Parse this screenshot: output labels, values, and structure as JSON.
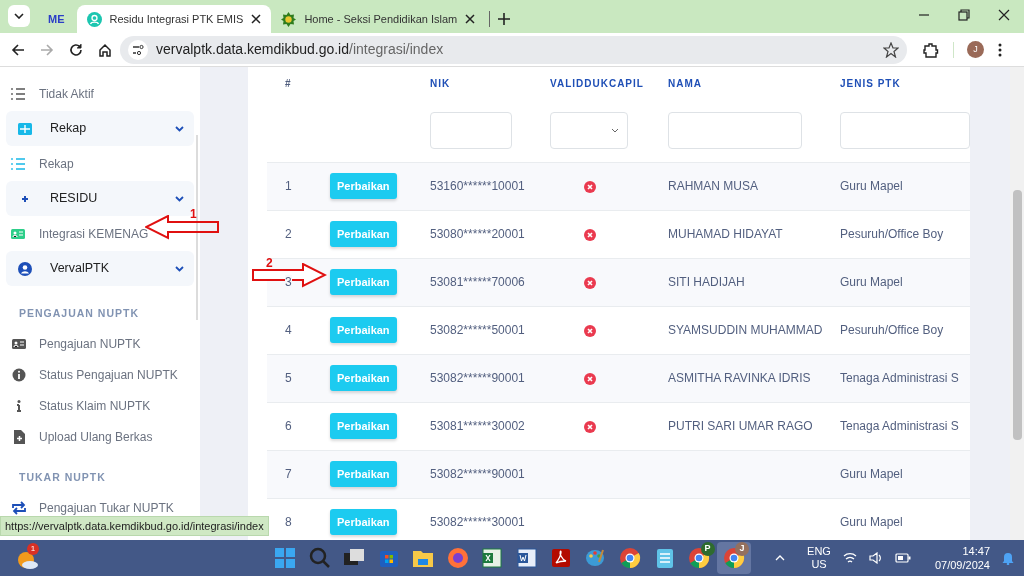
{
  "browser": {
    "tabs": [
      {
        "favicon_text": "ME",
        "selected": false
      },
      {
        "title": "Residu Integrasi PTK EMIS",
        "selected": true
      },
      {
        "title": "Home - Seksi Pendidikan Islam",
        "selected": false
      }
    ],
    "url": {
      "host": "vervalptk.data.kemdikbud.go.id",
      "path": "/integrasi/index"
    },
    "profile_letter": "J",
    "status_url": "https://vervalptk.data.kemdikbud.go.id/integrasi/index"
  },
  "sidebar": {
    "items": [
      {
        "kind": "link",
        "label": "Tidak Aktif"
      },
      {
        "kind": "group",
        "label": "Rekap",
        "expanded": true
      },
      {
        "kind": "link",
        "label": "Rekap"
      },
      {
        "kind": "group",
        "label": "RESIDU",
        "expanded": true
      },
      {
        "kind": "link",
        "label": "Integrasi KEMENAG"
      },
      {
        "kind": "group",
        "label": "VervalPTK",
        "expanded": true
      },
      {
        "kind": "heading",
        "label": "PENGAJUAN NUPTK"
      },
      {
        "kind": "link",
        "label": "Pengajuan NUPTK"
      },
      {
        "kind": "link",
        "label": "Status Pengajuan NUPTK"
      },
      {
        "kind": "link",
        "label": "Status Klaim NUPTK"
      },
      {
        "kind": "link",
        "label": "Upload Ulang Berkas"
      },
      {
        "kind": "heading",
        "label": "TUKAR NUPTK"
      },
      {
        "kind": "link",
        "label": "Pengajuan Tukar NUPTK"
      }
    ]
  },
  "table": {
    "columns": [
      "#",
      "NIK",
      "VALIDDUKCAPIL",
      "NAMA",
      "JENIS PTK"
    ],
    "filters": [
      {
        "kind": "text"
      },
      {
        "kind": "select"
      },
      {
        "kind": "text"
      },
      {
        "kind": "text"
      }
    ],
    "rows": [
      {
        "no": "1",
        "action": "Perbaikan",
        "nik": "53160******10001",
        "invalid": true,
        "nama": "RAHMAN MUSA",
        "jenis": "Guru Mapel"
      },
      {
        "no": "2",
        "action": "Perbaikan",
        "nik": "53080******20001",
        "invalid": true,
        "nama": "MUHAMAD HIDAYAT",
        "jenis": "Pesuruh/Office Boy"
      },
      {
        "no": "3",
        "action": "Perbaikan",
        "nik": "53081******70006",
        "invalid": true,
        "nama": "SITI HADIJAH",
        "jenis": "Guru Mapel"
      },
      {
        "no": "4",
        "action": "Perbaikan",
        "nik": "53082******50001",
        "invalid": true,
        "nama": "SYAMSUDDIN MUHAMMAD",
        "jenis": "Pesuruh/Office Boy"
      },
      {
        "no": "5",
        "action": "Perbaikan",
        "nik": "53082******90001",
        "invalid": true,
        "nama": "ASMITHA RAVINKA IDRIS",
        "jenis": "Tenaga Administrasi S"
      },
      {
        "no": "6",
        "action": "Perbaikan",
        "nik": "53081******30002",
        "invalid": true,
        "nama": "PUTRI SARI UMAR RAGO",
        "jenis": "Tenaga Administrasi S"
      },
      {
        "no": "7",
        "action": "Perbaikan",
        "nik": "53082******90001",
        "invalid": false,
        "jenis": "Guru Mapel"
      },
      {
        "no": "8",
        "action": "Perbaikan",
        "nik": "53082******30001",
        "invalid": false,
        "jenis": "Guru Mapel"
      }
    ]
  },
  "annotations": [
    {
      "label": "1"
    },
    {
      "label": "2"
    }
  ],
  "taskbar": {
    "weather_badge": "1",
    "chrome_profiles": [
      {
        "letter": "P",
        "active": false
      },
      {
        "letter": "J",
        "active": true
      }
    ],
    "language": "ENG",
    "region": "US",
    "time": "14:47",
    "date": "07/09/2024"
  }
}
